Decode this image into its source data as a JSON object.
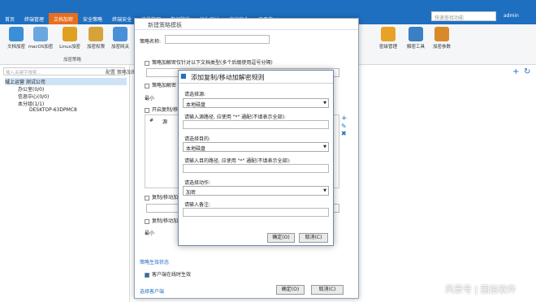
{
  "top": {
    "tabs": [
      "首页",
      "终端管理",
      "文档加密",
      "安全策略",
      "终端安全",
      "流量管理",
      "数据防泄",
      "行为审计",
      "文档安全",
      "工具箱"
    ],
    "active_tab": 2,
    "search_placeholder": "快速查找功能",
    "user": "admin"
  },
  "ribbon": {
    "buttons": [
      "文档加密",
      "macOS加密",
      "Linux加密",
      "加密权限",
      "加密网关"
    ],
    "right_buttons": [
      "密级管理",
      "解密工具",
      "加密参数"
    ],
    "group_label": "加密策略"
  },
  "tree": {
    "placeholder": "输入关键字搜索...",
    "nodes": [
      "域上运营 测试公司",
      "办公室(0/0)",
      "信息中心(0/0)",
      "本分组(1/1)",
      "DESKTOP-63DPMC8"
    ]
  },
  "crumb": "配置 策略加密规则",
  "dialog_outer": {
    "title": "新建策略模板",
    "name_label": "策略名称:",
    "opt1": "策略加解密仅针对以下文档类型(多个后缀使用逗号分隔)",
    "opt2": "策略加解密",
    "min_label": "最小",
    "opt3": "开启复制/移动",
    "col_hash": "#",
    "col_src": "源",
    "opt4": "复制/移动加",
    "opt5": "复制/移动加",
    "min_label2": "最小",
    "status_title": "策略生效状态",
    "status_item": "客户端在线时生效",
    "select_client": "选择客户端",
    "ok": "确定(O)",
    "cancel": "取消(C)"
  },
  "dialog_inner": {
    "title": "添加复制/移动加解密规则",
    "src_label": "请选择源:",
    "src_value": "本地磁盘",
    "src_path_label": "请输入源路径, 应使用 \"*\" 通配(不填表示全部):",
    "dst_label": "请选择目的:",
    "dst_value": "本地磁盘",
    "dst_path_label": "请输入目的路径, 应使用 \"*\" 通配(不填表示全部):",
    "action_label": "请选择动作:",
    "action_value": "加密",
    "note_label": "请输入备注:",
    "ok": "确定(O)",
    "cancel": "取消(C)"
  },
  "watermark": "风景号 | 固信软件"
}
